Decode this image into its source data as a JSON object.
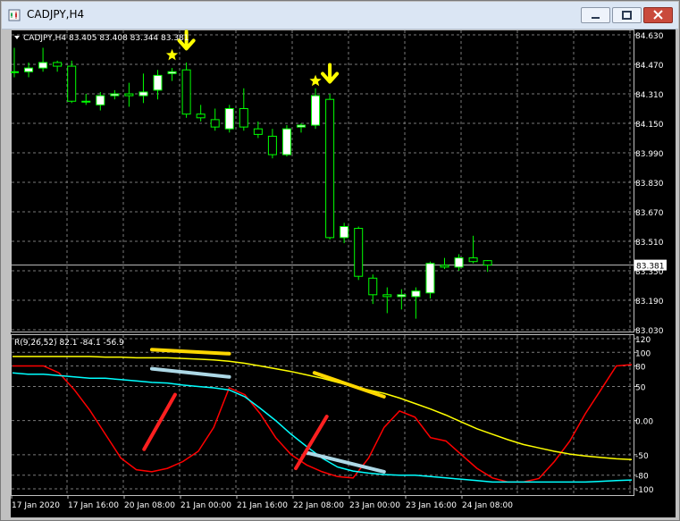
{
  "window": {
    "title": "CADJPY,H4",
    "buttons": [
      "minimize",
      "maximize",
      "close"
    ]
  },
  "chart_data": [
    {
      "type": "candlestick",
      "title": "CADJPY,H4",
      "ohlc_header": "83.405 83.408 83.344 83.381",
      "current_price": 83.381,
      "current_price_label": "83.381",
      "ylim": [
        83.03,
        84.63
      ],
      "y_ticks": [
        "84.630",
        "84.470",
        "84.310",
        "84.150",
        "83.990",
        "83.830",
        "83.670",
        "83.510",
        "83.350",
        "83.190",
        "83.030"
      ],
      "grid": true,
      "colors": {
        "up": "#ffffff",
        "down": "#000000",
        "wick": "#00ff00",
        "border": "#00ff00",
        "background": "#000000"
      },
      "candles": [
        {
          "o": 84.43,
          "h": 84.56,
          "l": 84.4,
          "c": 84.43
        },
        {
          "o": 84.43,
          "h": 84.48,
          "l": 84.4,
          "c": 84.45
        },
        {
          "o": 84.45,
          "h": 84.56,
          "l": 84.43,
          "c": 84.48
        },
        {
          "o": 84.48,
          "h": 84.49,
          "l": 84.43,
          "c": 84.46
        },
        {
          "o": 84.46,
          "h": 84.49,
          "l": 84.26,
          "c": 84.27
        },
        {
          "o": 84.27,
          "h": 84.31,
          "l": 84.25,
          "c": 84.27
        },
        {
          "o": 84.25,
          "h": 84.32,
          "l": 84.22,
          "c": 84.3
        },
        {
          "o": 84.3,
          "h": 84.33,
          "l": 84.28,
          "c": 84.31
        },
        {
          "o": 84.31,
          "h": 84.37,
          "l": 84.24,
          "c": 84.3
        },
        {
          "o": 84.3,
          "h": 84.42,
          "l": 84.26,
          "c": 84.32
        },
        {
          "o": 84.33,
          "h": 84.44,
          "l": 84.28,
          "c": 84.41
        },
        {
          "o": 84.42,
          "h": 84.45,
          "l": 84.38,
          "c": 84.43
        },
        {
          "o": 84.44,
          "h": 84.48,
          "l": 84.18,
          "c": 84.2
        },
        {
          "o": 84.2,
          "h": 84.25,
          "l": 84.16,
          "c": 84.18
        },
        {
          "o": 84.17,
          "h": 84.23,
          "l": 84.11,
          "c": 84.13
        },
        {
          "o": 84.12,
          "h": 84.25,
          "l": 84.1,
          "c": 84.23
        },
        {
          "o": 84.23,
          "h": 84.34,
          "l": 84.11,
          "c": 84.13
        },
        {
          "o": 84.12,
          "h": 84.16,
          "l": 84.07,
          "c": 84.09
        },
        {
          "o": 84.08,
          "h": 84.12,
          "l": 83.96,
          "c": 83.98
        },
        {
          "o": 83.98,
          "h": 84.14,
          "l": 83.97,
          "c": 84.12
        },
        {
          "o": 84.13,
          "h": 84.15,
          "l": 84.1,
          "c": 84.14
        },
        {
          "o": 84.14,
          "h": 84.34,
          "l": 84.12,
          "c": 84.3
        },
        {
          "o": 84.28,
          "h": 84.31,
          "l": 83.52,
          "c": 83.53
        },
        {
          "o": 83.53,
          "h": 83.61,
          "l": 83.5,
          "c": 83.59
        },
        {
          "o": 83.58,
          "h": 83.59,
          "l": 83.3,
          "c": 83.32
        },
        {
          "o": 83.31,
          "h": 83.33,
          "l": 83.17,
          "c": 83.22
        },
        {
          "o": 83.22,
          "h": 83.26,
          "l": 83.12,
          "c": 83.21
        },
        {
          "o": 83.21,
          "h": 83.25,
          "l": 83.14,
          "c": 83.22
        },
        {
          "o": 83.21,
          "h": 83.26,
          "l": 83.09,
          "c": 83.24
        },
        {
          "o": 83.23,
          "h": 83.4,
          "l": 83.2,
          "c": 83.39
        },
        {
          "o": 83.38,
          "h": 83.42,
          "l": 83.36,
          "c": 83.37
        },
        {
          "o": 83.37,
          "h": 83.44,
          "l": 83.35,
          "c": 83.42
        },
        {
          "o": 83.42,
          "h": 83.54,
          "l": 83.39,
          "c": 83.4
        },
        {
          "o": 83.405,
          "h": 83.408,
          "l": 83.344,
          "c": 83.381
        }
      ],
      "annotations": [
        {
          "type": "star",
          "color": "#ffff00",
          "candle": 11,
          "price": 84.52
        },
        {
          "type": "arrow-down",
          "color": "#ffff00",
          "candle": 12,
          "price": 84.57
        },
        {
          "type": "star",
          "color": "#ffff00",
          "candle": 21,
          "price": 84.38
        },
        {
          "type": "arrow-down",
          "color": "#ffff00",
          "candle": 22,
          "price": 84.39
        }
      ]
    },
    {
      "type": "line",
      "title": "R(9,26,52) 82.1 -84.1 -56.9",
      "ylim": [
        -100,
        120
      ],
      "y_ticks": [
        "120",
        "100",
        "80",
        "50",
        "0.00",
        "-50",
        "-80",
        "-100"
      ],
      "x_tick_labels": [
        "17 Jan 2020",
        "17 Jan 16:00",
        "20 Jan 08:00",
        "21 Jan 00:00",
        "21 Jan 16:00",
        "22 Jan 08:00",
        "23 Jan 00:00",
        "23 Jan 16:00",
        "24 Jan 08:00"
      ],
      "grid": true,
      "series": [
        {
          "color": "#ff0000",
          "values": [
            80,
            80,
            80,
            70,
            45,
            15,
            -20,
            -55,
            -72,
            -75,
            -70,
            -60,
            -45,
            -10,
            48,
            38,
            10,
            -25,
            -50,
            -65,
            -75,
            -82,
            -84,
            -55,
            -10,
            14,
            5,
            -25,
            -30,
            -50,
            -70,
            -84,
            -90,
            -90,
            -85,
            -60,
            -30,
            10,
            45,
            80,
            82
          ]
        },
        {
          "color": "#00ffff",
          "values": [
            70,
            68,
            68,
            66,
            64,
            62,
            62,
            60,
            58,
            56,
            55,
            52,
            50,
            48,
            45,
            35,
            18,
            0,
            -20,
            -38,
            -55,
            -68,
            -74,
            -77,
            -79,
            -80,
            -80,
            -82,
            -84,
            -86,
            -88,
            -90,
            -90,
            -90,
            -90,
            -90,
            -90,
            -90,
            -89,
            -88,
            -87
          ]
        },
        {
          "color": "#ffff00",
          "values": [
            94,
            94,
            94,
            94,
            94,
            94,
            93,
            93,
            92,
            92,
            92,
            91,
            90,
            89,
            87,
            84,
            80,
            76,
            72,
            67,
            62,
            56,
            50,
            45,
            40,
            33,
            25,
            17,
            8,
            -2,
            -12,
            -20,
            -28,
            -35,
            -40,
            -45,
            -49,
            -52,
            -54,
            -56,
            -57
          ]
        }
      ],
      "annotations": [
        {
          "type": "line",
          "color": "#ffd700",
          "x1": 9.0,
          "y1": 104,
          "x2": 14.0,
          "y2": 98
        },
        {
          "type": "line",
          "color": "#add8e6",
          "x1": 9.0,
          "y1": 76,
          "x2": 14.0,
          "y2": 64
        },
        {
          "type": "line",
          "color": "#ffd700",
          "x1": 19.5,
          "y1": 70,
          "x2": 24.0,
          "y2": 35
        },
        {
          "type": "line",
          "color": "#add8e6",
          "x1": 19.0,
          "y1": -47,
          "x2": 24.0,
          "y2": -75
        },
        {
          "type": "line",
          "color": "#ff2020",
          "x1": 8.5,
          "y1": -42,
          "x2": 10.5,
          "y2": 38
        },
        {
          "type": "line",
          "color": "#ff2020",
          "x1": 18.3,
          "y1": -70,
          "x2": 20.3,
          "y2": 6
        }
      ]
    }
  ]
}
